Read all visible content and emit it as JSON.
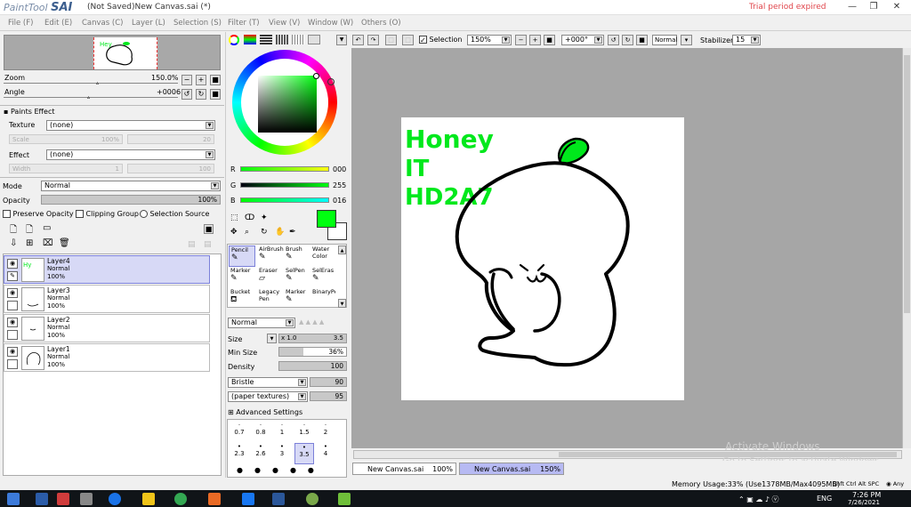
{
  "app": {
    "logo_small": "PaintTool",
    "logo_big": "SAI",
    "window_title": "(Not Saved)New Canvas.sai (*)",
    "trial": "Trial period expired",
    "win_min": "—",
    "win_max": "❐",
    "win_close": "✕"
  },
  "menu": [
    {
      "label": "File (F)"
    },
    {
      "label": "Edit (E)"
    },
    {
      "label": "Canvas (C)"
    },
    {
      "label": "Layer (L)"
    },
    {
      "label": "Selection (S)"
    },
    {
      "label": "Filter (T)"
    },
    {
      "label": "View (V)"
    },
    {
      "label": "Window (W)"
    },
    {
      "label": "Others (O)"
    }
  ],
  "navigator": {
    "zoom_label": "Zoom",
    "zoom_value": "150.0%",
    "angle_label": "Angle",
    "angle_value": "+0006",
    "btn_minus": "−",
    "btn_plus": "+",
    "btn_reset": "■"
  },
  "paints_effect": {
    "title": "Paints Effect",
    "texture_label": "Texture",
    "texture_value": "(none)",
    "scale_label": "Scale",
    "scale_value": "100%",
    "scale_num": "20",
    "effect_label": "Effect",
    "effect_value": "(none)",
    "width_label": "Width",
    "width_value": "1",
    "width_num": "100"
  },
  "layer_props": {
    "mode_label": "Mode",
    "mode_value": "Normal",
    "opacity_label": "Opacity",
    "opacity_value": "100%",
    "preserve_opacity": "Preserve Opacity",
    "clipping_group": "Clipping Group",
    "selection_source": "Selection Source"
  },
  "layers": [
    {
      "name": "Layer4",
      "mode": "Normal",
      "opacity": "100%",
      "selected": true
    },
    {
      "name": "Layer3",
      "mode": "Normal",
      "opacity": "100%",
      "selected": false
    },
    {
      "name": "Layer2",
      "mode": "Normal",
      "opacity": "100%",
      "selected": false
    },
    {
      "name": "Layer1",
      "mode": "Normal",
      "opacity": "100%",
      "selected": false
    }
  ],
  "color": {
    "r_label": "R",
    "r_value": "000",
    "g_label": "G",
    "g_value": "255",
    "b_label": "B",
    "b_value": "016",
    "primary": "#00ff10",
    "secondary": "#ffffff"
  },
  "tools": [
    {
      "label": "Pencil",
      "selected": true
    },
    {
      "label": "AirBrush",
      "selected": false
    },
    {
      "label": "Brush",
      "selected": false
    },
    {
      "label": "Water Color",
      "selected": false
    },
    {
      "label": "Marker",
      "selected": false
    },
    {
      "label": "Eraser",
      "selected": false
    },
    {
      "label": "SelPen",
      "selected": false
    },
    {
      "label": "SelEras",
      "selected": false
    },
    {
      "label": "Bucket",
      "selected": false
    },
    {
      "label": "Legacy Pen",
      "selected": false
    },
    {
      "label": "Marker",
      "selected": false
    },
    {
      "label": "BinaryPe",
      "selected": false
    }
  ],
  "brush": {
    "blend_mode": "Normal",
    "size_label": "Size",
    "size_mult": "x 1.0",
    "size_value": "3.5",
    "min_size_label": "Min Size",
    "min_size_value": "36%",
    "density_label": "Density",
    "density_value": "100",
    "shape": "Bristle",
    "shape_value": "90",
    "texture": "(paper textures)",
    "texture_value": "95",
    "advanced": "Advanced Settings",
    "sizes_row1": [
      "0.7",
      "0.8",
      "1",
      "1.5",
      "2"
    ],
    "sizes_row2": [
      "2.3",
      "2.6",
      "3",
      "3.5",
      "4"
    ],
    "selected_size": "3.5"
  },
  "canvas_toolbar": {
    "selection_label": "Selection",
    "zoom": "150%",
    "rotation": "+000°",
    "blend": "Normal",
    "stabilizer_label": "Stabilizer",
    "stabilizer_value": "15"
  },
  "drawing": {
    "text_line1": "Honey",
    "text_line2": "IT",
    "text_line3": "HD2A7",
    "ink_color": "#00e81c"
  },
  "tabs": [
    {
      "label": "New Canvas.sai",
      "zoom": "100%",
      "selected": false
    },
    {
      "label": "New Canvas.sai",
      "zoom": "150%",
      "selected": true
    }
  ],
  "watermark": {
    "line1": "Activate Windows",
    "line2": "Go to Settings to activate Windows."
  },
  "status": {
    "memory": "Memory Usage:33% (Use1378MB/Max4095MB)",
    "keys": "Shft Ctrl Alt SPC",
    "keys_ctl": "◉ Any"
  },
  "taskbar": {
    "lang": "ENG",
    "time": "7:26 PM",
    "date": "7/26/2021"
  }
}
